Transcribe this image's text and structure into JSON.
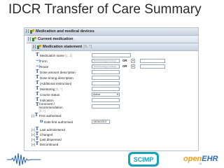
{
  "slide": {
    "title": "IDCR Transfer of Care Summary",
    "number": "14"
  },
  "form": {
    "section1": {
      "toggle": "[-]",
      "label": "Medication and medical devices"
    },
    "section2": {
      "toggle": "[-]",
      "label": "Current medication"
    },
    "section3": {
      "toggle": "[-]",
      "label": "Medication statement",
      "occurrence": "[0..*]"
    },
    "rows": [
      {
        "icon": "T",
        "label": "Medication name",
        "occurrence": "[1..1]"
      },
      {
        "icon": "→|",
        "label": "Form",
        "placeholder": "Terminology lookup",
        "or_label": "OR",
        "occurrence": ""
      },
      {
        "icon": "→|",
        "label": "Route",
        "placeholder": "Terminology lookup",
        "or_label": "OR",
        "occurrence": ""
      },
      {
        "icon": "T",
        "label": "Dose amount description",
        "occurrence": ""
      },
      {
        "icon": "T",
        "label": "Dose timing description",
        "occurrence": ""
      },
      {
        "icon": "T",
        "label": "(Additional instruction)",
        "occurrence": ""
      },
      {
        "icon": "T",
        "label": "Monitoring",
        "occurrence": "[0..*]"
      },
      {
        "icon": "T",
        "label": "Course status",
        "value": "Active",
        "occurrence": ""
      },
      {
        "icon": "T",
        "label": "Indication",
        "occurrence": ""
      },
      {
        "icon": "T",
        "label": "Comment / recommendation",
        "occurrence": "[0..*]"
      },
      {
        "icon": "T",
        "label": "First authorised",
        "toggle": "[-]",
        "occurrence": ""
      },
      {
        "icon": "D",
        "label": "Date first authorised",
        "value": "14/04/2013",
        "occurrence": ""
      },
      {
        "icon": "T",
        "label": "Last administered",
        "toggle": "[+]",
        "occurrence": ""
      },
      {
        "icon": "T",
        "label": "Changed",
        "toggle": "[+]",
        "occurrence": ""
      },
      {
        "icon": "T",
        "label": "Last dispensed",
        "toggle": "[+]",
        "occurrence": ""
      },
      {
        "icon": "T",
        "label": "Discontinued",
        "toggle": "[+]",
        "occurrence": ""
      }
    ]
  },
  "footer": {
    "scimp_logo": "SCIMP",
    "openehr_logo_part1": "open",
    "openehr_logo_part2": "EHR"
  },
  "colors": {
    "accent_blue": "#1b4e8c",
    "section_green": "#3a8a3a",
    "openehr_orange": "#f39a1d",
    "openehr_blue": "#2a6db5",
    "scimp_teal": "#1aa3b8"
  },
  "icons": {
    "section": "archetype-icon",
    "text": "text-type-icon",
    "coded": "coded-text-icon",
    "date": "date-icon",
    "wave": "audio-wave-icon"
  }
}
